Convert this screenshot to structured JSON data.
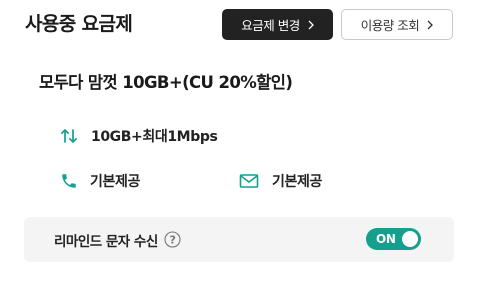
{
  "header": {
    "title": "사용중 요금제",
    "change_plan_label": "요금제 변경",
    "usage_label": "이용량 조회"
  },
  "plan": {
    "name": "모두다 맘껏 10GB+(CU 20%할인)",
    "data": "10GB+최대1Mbps",
    "voice": "기본제공",
    "sms": "기본제공"
  },
  "reminder": {
    "label": "리마인드 문자 수신",
    "toggle_label": "ON",
    "enabled": true
  },
  "icons": {
    "data": "data-transfer-icon",
    "voice": "phone-icon",
    "sms": "envelope-icon",
    "help": "question-icon",
    "chevron": "chevron-right-icon"
  },
  "colors": {
    "accent": "#14a08c",
    "highlight": "#d4f3ec",
    "dark_button": "#222222",
    "reminder_bg": "#f4f4f4"
  }
}
